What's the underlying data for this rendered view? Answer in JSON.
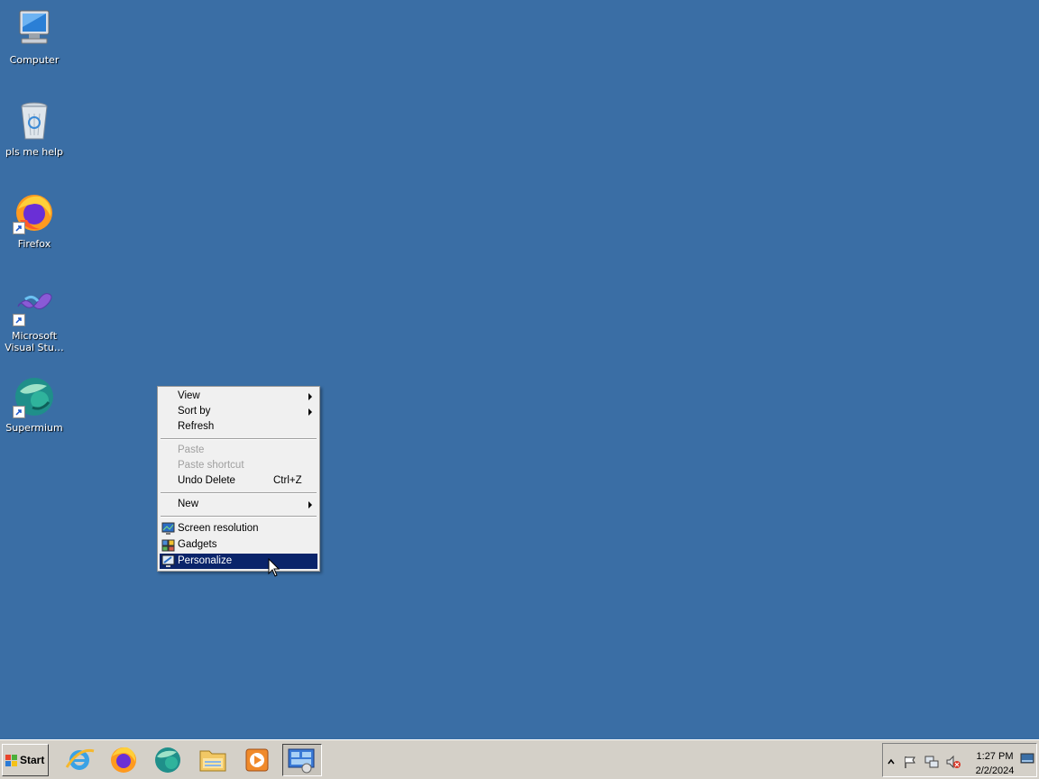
{
  "desktop": {
    "icons": [
      {
        "label": "Computer",
        "icon": "computer-icon"
      },
      {
        "label": "pls me help",
        "icon": "recycle-bin-icon"
      },
      {
        "label": "Firefox",
        "icon": "firefox-icon"
      },
      {
        "label_line1": "Microsoft",
        "label_line2": "Visual Stu…",
        "icon": "visual-studio-icon"
      },
      {
        "label": "Supermium",
        "icon": "supermium-icon"
      }
    ]
  },
  "context_menu": {
    "view": "View",
    "sort_by": "Sort by",
    "refresh": "Refresh",
    "paste": "Paste",
    "paste_shortcut": "Paste shortcut",
    "undo_delete": "Undo Delete",
    "undo_delete_key": "Ctrl+Z",
    "new": "New",
    "screen_resolution": "Screen resolution",
    "gadgets": "Gadgets",
    "personalize": "Personalize"
  },
  "taskbar": {
    "start_label": "Start",
    "pinned": [
      "internet-explorer-icon",
      "firefox-icon",
      "supermium-icon",
      "file-explorer-icon",
      "media-player-icon",
      "control-panel-icon"
    ],
    "clock_time": "1:27 PM",
    "clock_date": "2/2/2024"
  },
  "colors": {
    "desktop": "#3a6ea5",
    "menu_highlight": "#0a246a",
    "taskbar": "#d4d0c8"
  }
}
